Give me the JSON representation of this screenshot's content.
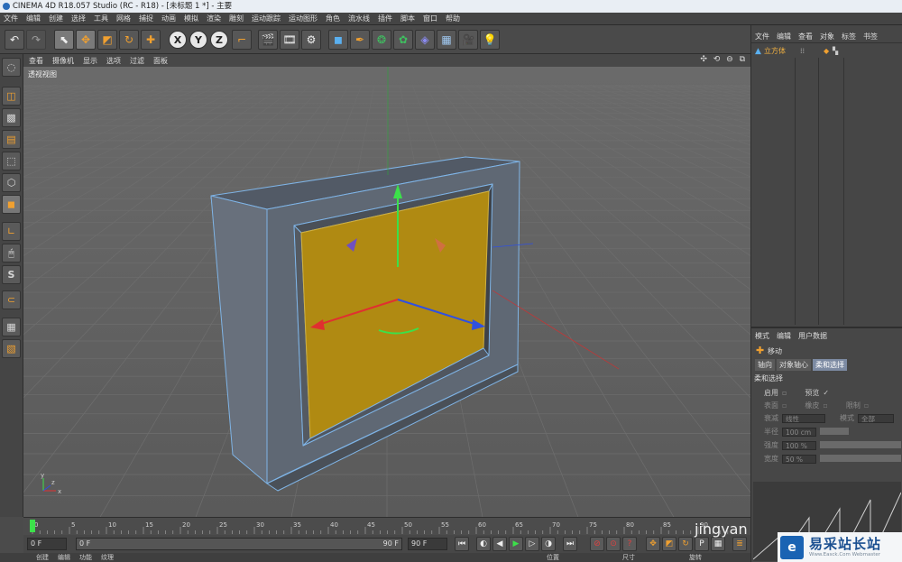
{
  "window": {
    "title": "CINEMA 4D R18.057 Studio (RC - R18) - [未标题 1 *] - 主要"
  },
  "menubar": [
    "文件",
    "编辑",
    "创建",
    "选择",
    "工具",
    "网格",
    "捕捉",
    "动画",
    "模拟",
    "渲染",
    "雕刻",
    "运动跟踪",
    "运动图形",
    "角色",
    "流水线",
    "插件",
    "脚本",
    "窗口",
    "帮助"
  ],
  "viewport": {
    "menu": [
      "查看",
      "摄像机",
      "显示",
      "选项",
      "过滤",
      "面板"
    ],
    "controls": "✣ ⟲ ⊖ ⧉",
    "label": "透视视图",
    "axis": {
      "x": "x",
      "y": "y",
      "z": "z"
    }
  },
  "object_manager": {
    "menu": [
      "文件",
      "编辑",
      "查看",
      "对象",
      "标签",
      "书签"
    ],
    "object_name": "立方体"
  },
  "attributes": {
    "menu": [
      "模式",
      "编辑",
      "用户数据"
    ],
    "mode_name": "移动",
    "tabs": [
      "轴向",
      "对象轴心",
      "柔和选择"
    ],
    "section": "柔和选择",
    "enable_label": "启用",
    "preview_label": "预览",
    "preview_check": "✓",
    "surface_label": "表面",
    "rubber_label": "橡皮",
    "restrict_label": "限制",
    "falloff_label": "衰减",
    "falloff_value": "线性",
    "mode_label": "模式",
    "mode_value": "全部",
    "radius_label": "半径",
    "radius_value": "100 cm",
    "strength_label": "强度",
    "strength_value": "100 %",
    "width_label": "宽度",
    "width_value": "50 %"
  },
  "timeline": {
    "ticks": [
      "0",
      "5",
      "10",
      "15",
      "20",
      "25",
      "30",
      "35",
      "40",
      "45",
      "50",
      "55",
      "60",
      "65",
      "70",
      "75",
      "80",
      "85",
      "90"
    ],
    "current": "0 F",
    "start": "0 F",
    "range_start": "0 F",
    "range_end": "90 F",
    "end": "90 F"
  },
  "bottom_strip": [
    "创建",
    "编辑",
    "功能",
    "纹理",
    "位置",
    "尺寸",
    "旋转"
  ],
  "watermark": {
    "logo": "e",
    "title": "易采站长站",
    "subtitle": "Www.Easck.Com Webmaster",
    "jingyan": "jingyan"
  }
}
